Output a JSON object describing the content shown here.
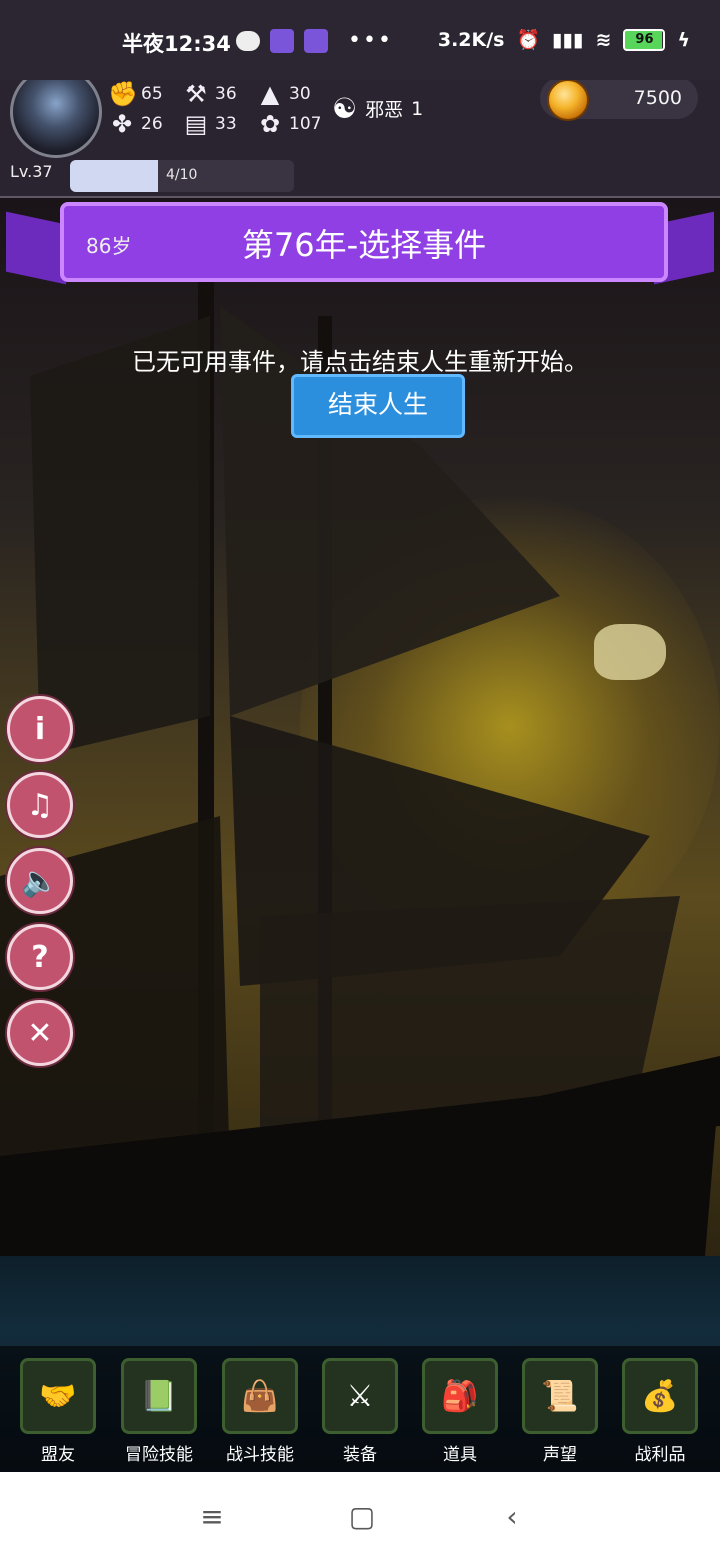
{
  "status": {
    "time": "半夜12:34",
    "speed": "3.2K/s",
    "battery": "96",
    "icons": [
      "wechat-icon",
      "app-icon-1",
      "app-icon-2",
      "more-dots-icon"
    ],
    "right_icons": [
      "alarm-icon",
      "signal-icon",
      "wifi-icon",
      "battery-icon",
      "charging-icon"
    ]
  },
  "header": {
    "avatar_icon": "character-avatar",
    "stats": [
      {
        "name": "strength",
        "icon": "fist-icon",
        "value": "65"
      },
      {
        "name": "luck",
        "icon": "clover-icon",
        "value": "26"
      },
      {
        "name": "intelligence",
        "icon": "hammer-icon",
        "value": "36"
      },
      {
        "name": "charm",
        "icon": "scroll-icon",
        "value": "33"
      },
      {
        "name": "magic",
        "icon": "wizard-hat-icon",
        "value": "30"
      },
      {
        "name": "wisdom",
        "icon": "lotus-icon",
        "value": "107"
      }
    ],
    "alignment": {
      "icon": "yin-yang-icon",
      "label": "邪恶",
      "value": "1"
    },
    "coins": "7500",
    "level": "Lv.37",
    "xp_text": "4/10",
    "xp_fraction": 0.4
  },
  "banner": {
    "age": "86岁",
    "title": "第76年-选择事件"
  },
  "content": {
    "message": "已无可用事件，请点击结束人生重新开始。",
    "end_button": "结束人生"
  },
  "side_buttons": [
    {
      "name": "info-button",
      "icon": "info-icon",
      "glyph": "i"
    },
    {
      "name": "music-button",
      "icon": "music-note-icon",
      "glyph": "♫"
    },
    {
      "name": "sound-button",
      "icon": "speaker-icon",
      "glyph": "🔈"
    },
    {
      "name": "help-button",
      "icon": "question-icon",
      "glyph": "?"
    },
    {
      "name": "close-button",
      "icon": "close-icon",
      "glyph": "✕"
    }
  ],
  "dock": [
    {
      "label": "盟友",
      "icon": "handshake-icon",
      "glyph": "🤝"
    },
    {
      "label": "冒险技能",
      "icon": "spellbook-icon",
      "glyph": "📗"
    },
    {
      "label": "战斗技能",
      "icon": "satchel-icon",
      "glyph": "👜"
    },
    {
      "label": "装备",
      "icon": "crossed-swords-icon",
      "glyph": "⚔"
    },
    {
      "label": "道具",
      "icon": "pouch-icon",
      "glyph": "🎒"
    },
    {
      "label": "声望",
      "icon": "parchment-icon",
      "glyph": "📜"
    },
    {
      "label": "战利品",
      "icon": "treasure-chest-icon",
      "glyph": "💰"
    }
  ],
  "nav": {
    "menu_icon": "≡",
    "home_icon": "▢",
    "back_icon": "‹"
  }
}
